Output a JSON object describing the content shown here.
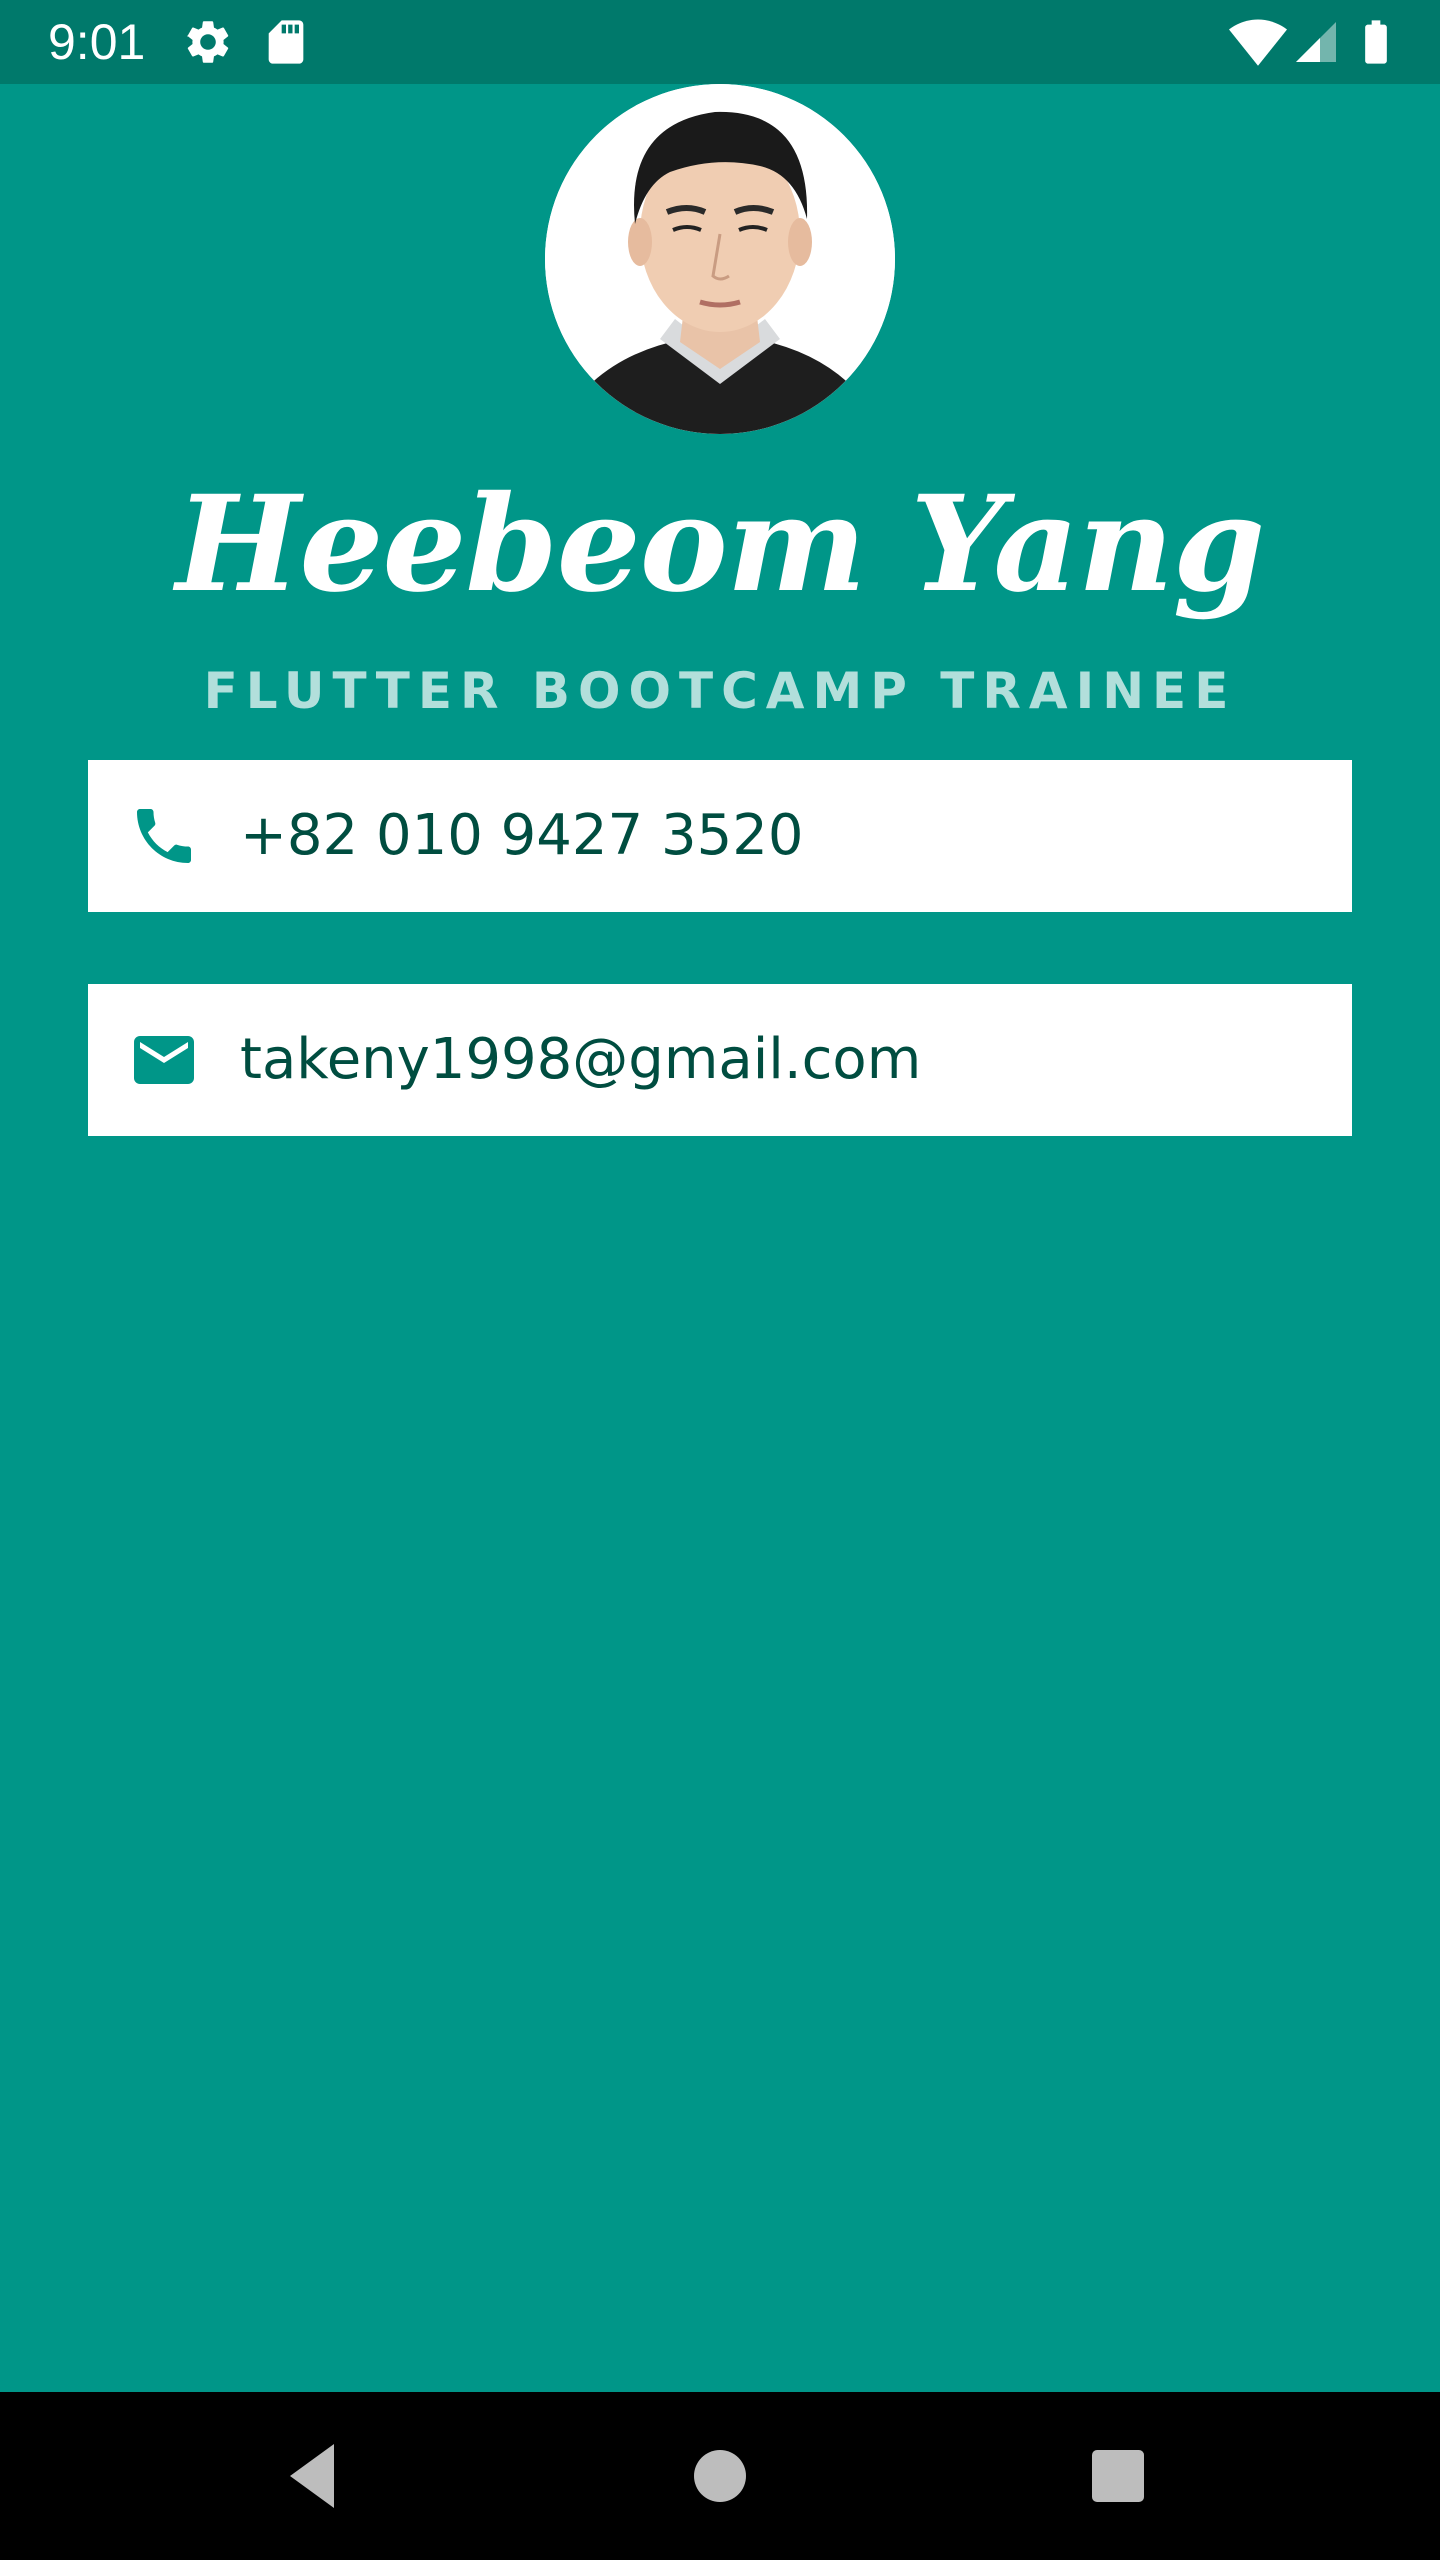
{
  "status_bar": {
    "time": "9:01",
    "icons": [
      "settings-icon",
      "sd-card-icon",
      "wifi-icon",
      "cell-signal-icon",
      "battery-icon"
    ]
  },
  "profile": {
    "name": "Heebeom Yang",
    "title": "FLUTTER BOOTCAMP TRAINEE"
  },
  "contacts": [
    {
      "icon": "phone-icon",
      "text": "+82 010 9427 3520"
    },
    {
      "icon": "mail-icon",
      "text": "takeny1998@gmail.com"
    }
  ],
  "nav_bar": {
    "buttons": [
      "back-button",
      "home-button",
      "recents-button"
    ]
  },
  "colors": {
    "background": "#009688",
    "status_bar": "#00796B",
    "subtitle": "#B2DFDB",
    "icon": "#009688",
    "card_text": "#004D40"
  }
}
